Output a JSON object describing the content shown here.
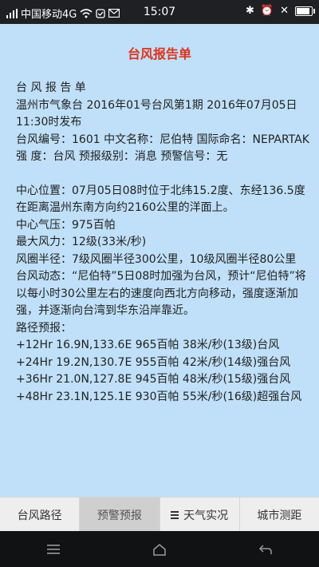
{
  "status": {
    "carrier": "中国移动4G",
    "time": "15:07",
    "battery_level": 0.8
  },
  "page_title": "台风报告单",
  "report": {
    "heading": "台 风 报 告 单",
    "issuer": "温州市气象台 2016年01号台风第1期 2016年07月05日11:30时发布",
    "number_line": "台风编号：1601 中文名称：尼伯特 国际命名：NEPARTAK",
    "strength_line": "强 度：台风 预报级别：消息 预警信号：无",
    "center_position": "中心位置：07月05日08时位于北纬15.2度、东经136.5度",
    "distance": "在距离温州东南方向约2160公里的洋面上。",
    "pressure": "中心气压：975百帕",
    "max_wind": "最大风力：12级(33米/秒)",
    "wind_radius": "风圈半径：7级风圈半径300公里，10级风圈半径80公里",
    "dynamics": "台风动态：“尼伯特”5日08时加强为台风，预计“尼伯特”将以每小时30公里左右的速度向西北方向移动，强度逐渐加强，并逐渐向台湾到华东沿岸靠近。",
    "forecast_title": "路径预报：",
    "forecast": [
      "+12Hr 16.9N,133.6E 965百帕 38米/秒(13级)台风",
      "+24Hr 19.2N,130.7E 955百帕 42米/秒(14级)强台风",
      "+36Hr 21.0N,127.8E 945百帕 48米/秒(15级)强台风",
      "+48Hr 23.1N,125.1E 930百帕 55米/秒(16级)超强台风"
    ]
  },
  "tabs": [
    {
      "label": "台风路径"
    },
    {
      "label": "预警预报"
    },
    {
      "label": "天气实况"
    },
    {
      "label": "城市测距"
    }
  ]
}
